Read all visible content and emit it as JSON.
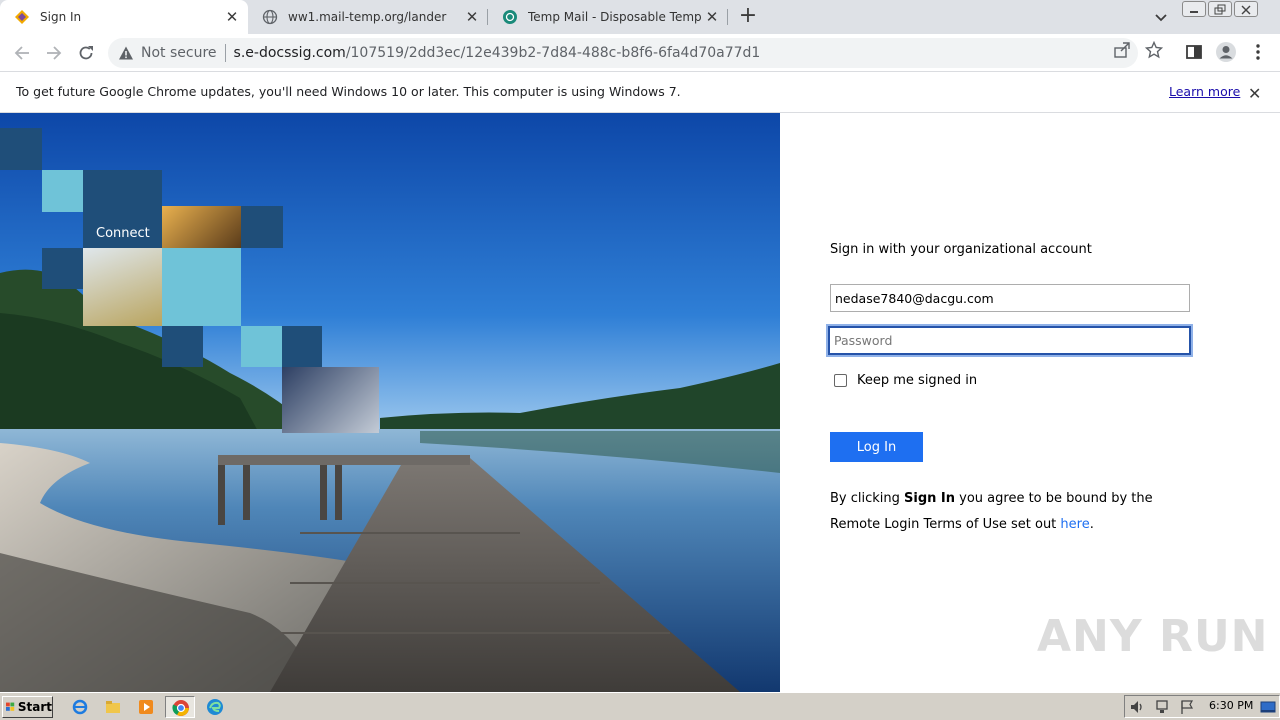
{
  "browser": {
    "tabs": [
      {
        "title": "Sign In",
        "active": true,
        "icon": "adfs-diamond-icon"
      },
      {
        "title": "ww1.mail-temp.org/lander",
        "active": false,
        "icon": "globe-icon"
      },
      {
        "title": "Temp Mail - Disposable Temporary Em",
        "active": false,
        "icon": "tempmail-icon"
      }
    ],
    "security_label": "Not secure",
    "url_host": "s.e-docssig.com",
    "url_path": "/107519/2dd3ec/12e439b2-7d84-488c-b8f6-6fa4d70a77d1"
  },
  "infobar": {
    "message": "To get future Google Chrome updates, you'll need Windows 10 or later. This computer is using Windows 7.",
    "learn_more": "Learn more"
  },
  "hero": {
    "tile_caption": "Connect"
  },
  "login": {
    "heading": "Sign in with your organizational account",
    "email_value": "nedase7840@dacgu.com",
    "password_placeholder": "Password",
    "keep_signed_in": "Keep me signed in",
    "keep_signed_in_checked": false,
    "login_button": "Log In",
    "terms_prefix": "By clicking ",
    "terms_bold": "Sign In",
    "terms_middle": " you agree to be bound by the Remote Login Terms of Use set out ",
    "terms_link": "here",
    "terms_suffix": "."
  },
  "watermark": "ANY RUN",
  "taskbar": {
    "start_label": "Start",
    "clock": "6:30 PM",
    "pinned": [
      "ie-icon",
      "explorer-icon",
      "media-player-icon",
      "chrome-icon",
      "edge-icon"
    ]
  },
  "colors": {
    "accent": "#1e6ff1",
    "tile_dark": "#1f4e79",
    "tile_light": "#6fc3d8"
  }
}
